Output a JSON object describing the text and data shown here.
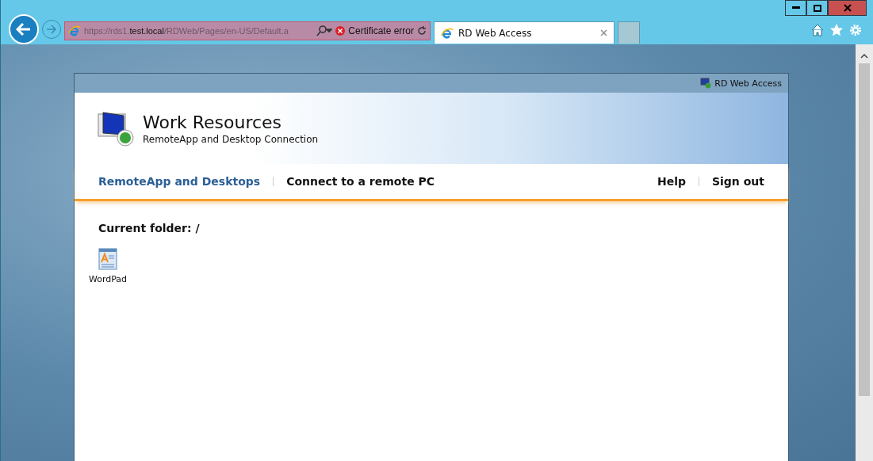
{
  "browser": {
    "address": {
      "scheme_sub": "https://rds1.",
      "host": "test.local",
      "path": "/RDWeb/Pages/en-US/Default.a"
    },
    "certificate": "Certificate error",
    "tabs": [
      {
        "title": "RD Web Access",
        "selected": true
      }
    ]
  },
  "page": {
    "header_label": "RD Web Access",
    "title": "Work Resources",
    "subtitle": "RemoteApp and Desktop Connection",
    "nav_left": [
      {
        "label": "RemoteApp and Desktops",
        "selected": true
      },
      {
        "label": "Connect to a remote PC",
        "selected": false
      }
    ],
    "nav_right": [
      {
        "label": "Help"
      },
      {
        "label": "Sign out"
      }
    ],
    "folder": "Current folder: /",
    "apps": [
      {
        "name": "WordPad"
      }
    ]
  }
}
